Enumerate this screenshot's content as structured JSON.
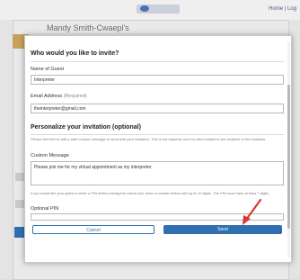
{
  "header": {
    "name": "Mandy Smith-Cwaepl's",
    "links": "Home | Log"
  },
  "modal": {
    "title": "Who would you like to invite?",
    "guest_name_label": "Name of Guest",
    "guest_name_value": "Interpreter",
    "email_label": "Email Address",
    "email_required": "(Required)",
    "email_value": "theinterpreter@gmail.com",
    "personalize_title": "Personalize your invitation (optional)",
    "personalize_help": "Please feel free to add a brief custom message to send with your invitation. This is not required, but it is often helpful to the recipient of the invitation.",
    "custom_message_label": "Custom Message",
    "custom_message_value": "Please join me for my virtual appointment as my interpreter.",
    "pin_help": "If you would like your guest to enter a PIN before joining the virtual visit, enter a number below with up to 10 digits. The PIN must have at least 7 digits.",
    "pin_label": "Optional PIN",
    "pin_value": "",
    "cancel_label": "Cancel",
    "send_label": "Send"
  },
  "colors": {
    "accent": "#2f6fb0",
    "arrow": "#e0362c"
  }
}
